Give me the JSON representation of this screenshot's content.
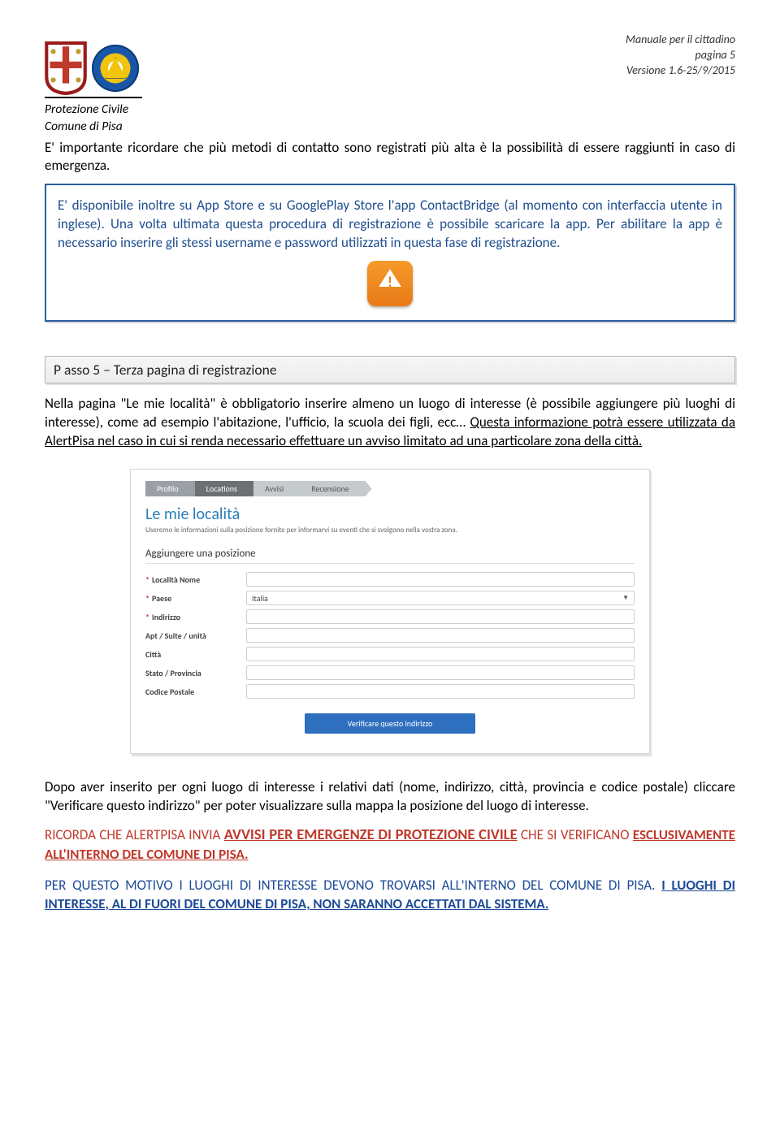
{
  "header": {
    "manual": "Manuale per il cittadino",
    "page": "pagina 5",
    "version": "Versione 1.6-25/9/2015"
  },
  "org": {
    "line1": "Protezione Civile",
    "line2": "Comune di Pisa"
  },
  "para_intro": "E' importante ricordare che più metodi di contatto sono registrati più alta è la possibilità di essere raggiunti in caso di emergenza.",
  "bluebox_text": "E' disponibile inoltre su App Store e su GooglePlay Store l'app ContactBridge (al momento con interfaccia utente in inglese). Una volta ultimata questa procedura di registrazione è possibile scaricare la app. Per abilitare la app è necessario inserire gli stessi username e password utilizzati in questa fase di registrazione.",
  "step_header": "P asso 5 – Terza pagina di registrazione",
  "para_step5_a": "Nella pagina \"Le mie località\" è obbligatorio inserire almeno un luogo di interesse (è possibile aggiungere più luoghi di interesse), come ad esempio l'abitazione, l'ufficio, la scuola dei figli, ecc… ",
  "para_step5_b": "Questa informazione potrà essere utilizzata da AlertPisa nel caso in cui si renda necessario effettuare un avviso limitato ad una particolare zona della città.",
  "screenshot": {
    "bc1": "Profilo",
    "bc2": "Locations",
    "bc3": "Avvisi",
    "bc4": "Recensione",
    "title": "Le mie località",
    "subtitle": "Useremo le informazioni sulla posizione fornite per informarvi su eventi che si svolgono nella vostra zona.",
    "section": "Aggiungere una posizione",
    "labels": {
      "nome": "Località Nome",
      "paese": "Paese",
      "indirizzo": "Indirizzo",
      "apt": "Apt / Suite / unità",
      "citta": "Città",
      "stato": "Stato / Provincia",
      "cap": "Codice Postale"
    },
    "paese_value": "Italia",
    "button": "Verificare questo indirizzo"
  },
  "para_after": "Dopo aver inserito per ogni luogo di interesse i relativi dati (nome, indirizzo, città, provincia e codice postale) cliccare \"Verificare questo indirizzo\" per poter visualizzare sulla mappa la posizione del luogo di interesse.",
  "red": {
    "pre": "RICORDA CHE ALERTPISA INVIA ",
    "big": "AVVISI PER EMERGENZE DI PROTEZIONE CIVILE",
    "post1": " CHE SI VERIFICANO ",
    "u2": "ESCLUSIVAMENTE ALL'INTERNO DEL COMUNE DI PISA."
  },
  "blue": {
    "a": "PER QUESTO MOTIVO I LUOGHI DI INTERESSE DEVONO TROVARSI ALL'INTERNO DEL COMUNE DI PISA. ",
    "b": "I LUOGHI DI INTERESSE, AL DI FUORI DEL COMUNE DI PISA, NON SARANNO ACCETTATI DAL SISTEMA."
  }
}
